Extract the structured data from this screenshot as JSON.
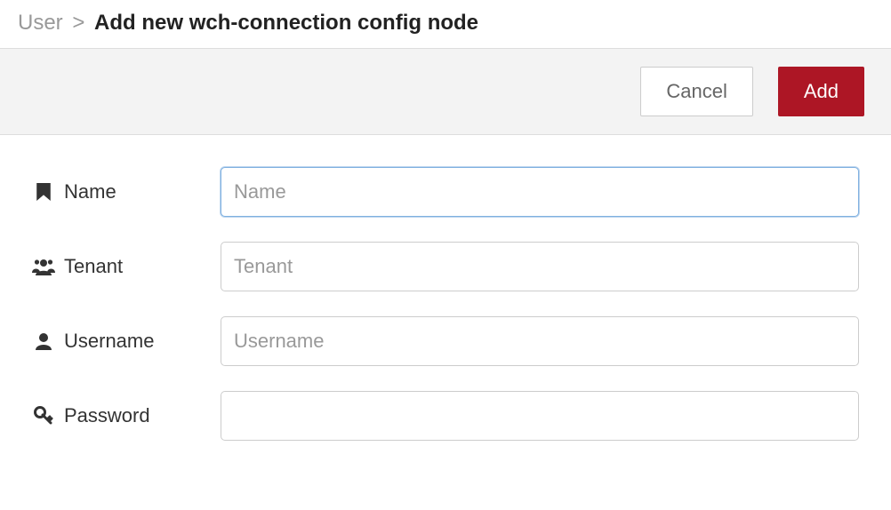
{
  "breadcrumb": {
    "parent": "User",
    "separator": ">",
    "title": "Add new wch-connection config node"
  },
  "toolbar": {
    "cancel_label": "Cancel",
    "add_label": "Add"
  },
  "form": {
    "name": {
      "label": "Name",
      "placeholder": "Name",
      "value": ""
    },
    "tenant": {
      "label": "Tenant",
      "placeholder": "Tenant",
      "value": ""
    },
    "username": {
      "label": "Username",
      "placeholder": "Username",
      "value": ""
    },
    "password": {
      "label": "Password",
      "placeholder": "",
      "value": ""
    }
  },
  "colors": {
    "accent": "#ad1625",
    "focus": "#7fb0e0"
  }
}
